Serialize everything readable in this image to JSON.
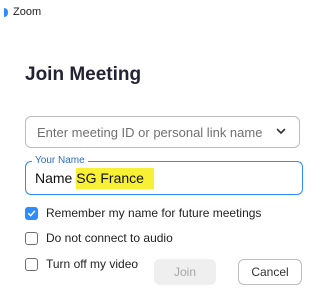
{
  "window": {
    "title": "Zoom",
    "icon": "zoom-logo-icon"
  },
  "dialog": {
    "heading": "Join Meeting",
    "meeting_id": {
      "placeholder": "Enter meeting ID or personal link name",
      "value": "",
      "dropdown_icon": "chevron-down-icon"
    },
    "name_field": {
      "label": "Your Name",
      "prefix": "Name",
      "highlighted_value": "SG France",
      "highlight_color": "#f7f035"
    },
    "options": [
      {
        "label": "Remember my name for future meetings",
        "checked": true
      },
      {
        "label": "Do not connect to audio",
        "checked": false
      },
      {
        "label": "Turn off my video",
        "checked": false
      }
    ],
    "buttons": {
      "join": "Join",
      "cancel": "Cancel"
    }
  },
  "colors": {
    "accent": "#2d8cff",
    "heading": "#232333"
  }
}
